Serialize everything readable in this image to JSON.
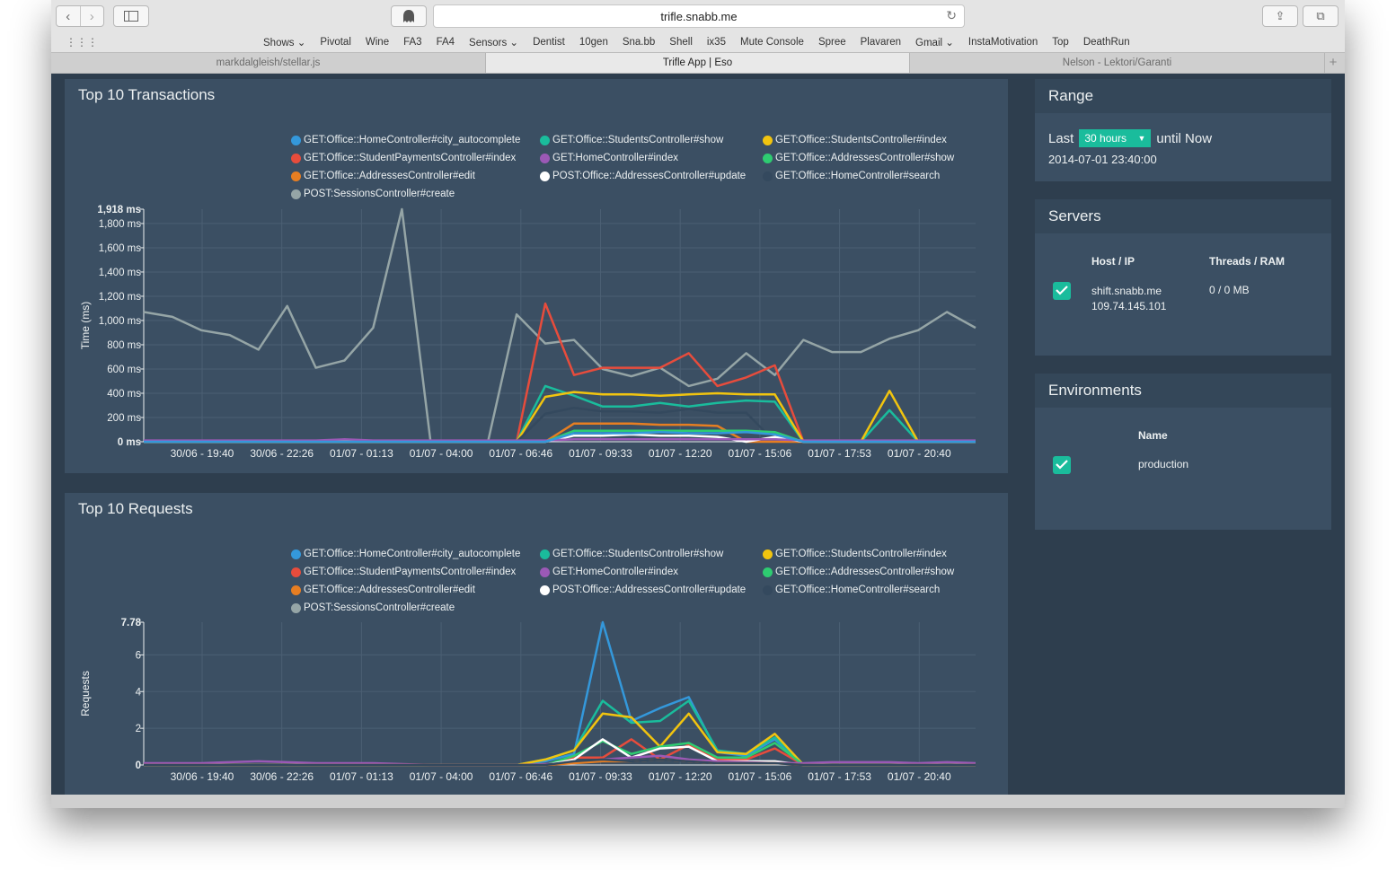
{
  "browser": {
    "url": "trifle.snabb.me",
    "bookmarks": [
      "Shows ⌄",
      "Pivotal",
      "Wine",
      "FA3",
      "FA4",
      "Sensors ⌄",
      "Dentist",
      "10gen",
      "Sna.bb",
      "Shell",
      "ix35",
      "Mute Console",
      "Spree",
      "Plavaren",
      "Gmail ⌄",
      "InstaMotivation",
      "Top",
      "DeathRun"
    ],
    "tabs": [
      "markdalgleish/stellar.js",
      "Trifle App | Eso",
      "Nelson - Lektori/Garanti"
    ]
  },
  "legend": [
    {
      "label": "GET:Office::HomeController#city_autocomplete",
      "color": "#3498db"
    },
    {
      "label": "GET:Office::StudentsController#show",
      "color": "#1abc9c"
    },
    {
      "label": "GET:Office::StudentsController#index",
      "color": "#f1c40f"
    },
    {
      "label": "GET:Office::StudentPaymentsController#index",
      "color": "#e74c3c"
    },
    {
      "label": "GET:HomeController#index",
      "color": "#9b59b6"
    },
    {
      "label": "GET:Office::AddressesController#show",
      "color": "#2ecc71"
    },
    {
      "label": "GET:Office::AddressesController#edit",
      "color": "#e67e22"
    },
    {
      "label": "POST:Office::AddressesController#update",
      "color": "#ffffff"
    },
    {
      "label": "GET:Office::HomeController#search",
      "color": "#34495e"
    },
    {
      "label": "POST:SessionsController#create",
      "color": "#95a5a6"
    }
  ],
  "x_ticks": [
    "30/06 - 19:40",
    "30/06 - 22:26",
    "01/07 - 01:13",
    "01/07 - 04:00",
    "01/07 - 06:46",
    "01/07 - 09:33",
    "01/07 - 12:20",
    "01/07 - 15:06",
    "01/07 - 17:53",
    "01/07 - 20:40"
  ],
  "chart_data": [
    {
      "type": "line",
      "title": "Top 10 Transactions",
      "ylabel": "Time (ms)",
      "y_max_label": "1,918 ms",
      "y_tick_labels": [
        "0 ms",
        "200 ms",
        "400 ms",
        "600 ms",
        "800 ms",
        "1,000 ms",
        "1,200 ms",
        "1,400 ms",
        "1,600 ms",
        "1,800 ms"
      ],
      "y_tick_values": [
        0,
        200,
        400,
        600,
        800,
        1000,
        1200,
        1400,
        1600,
        1800
      ],
      "ylim": [
        0,
        1918
      ],
      "x_ticks": [
        "30/06 - 19:40",
        "30/06 - 22:26",
        "01/07 - 01:13",
        "01/07 - 04:00",
        "01/07 - 06:46",
        "01/07 - 09:33",
        "01/07 - 12:20",
        "01/07 - 15:06",
        "01/07 - 17:53",
        "01/07 - 20:40"
      ],
      "series": [
        {
          "name": "POST:SessionsController#create",
          "color": "#95a5a6",
          "values": [
            1070,
            1030,
            920,
            880,
            760,
            1120,
            610,
            670,
            940,
            1918,
            0,
            0,
            0,
            1050,
            810,
            840,
            600,
            540,
            610,
            460,
            520,
            730,
            550,
            840,
            740,
            740,
            850,
            920,
            1070,
            940
          ]
        },
        {
          "name": "GET:Office::StudentPaymentsController#index",
          "color": "#e74c3c",
          "values": [
            0,
            0,
            0,
            0,
            0,
            0,
            0,
            0,
            0,
            0,
            0,
            0,
            0,
            0,
            1140,
            550,
            610,
            610,
            610,
            730,
            460,
            530,
            630,
            0,
            0,
            0,
            0,
            0,
            0,
            0
          ]
        },
        {
          "name": "GET:Office::StudentsController#show",
          "color": "#1abc9c",
          "values": [
            0,
            0,
            0,
            0,
            0,
            0,
            0,
            0,
            0,
            0,
            0,
            0,
            0,
            0,
            460,
            380,
            290,
            290,
            320,
            290,
            320,
            340,
            330,
            0,
            0,
            0,
            260,
            0,
            0,
            0
          ]
        },
        {
          "name": "GET:Office::StudentsController#index",
          "color": "#f1c40f",
          "values": [
            0,
            0,
            0,
            0,
            0,
            0,
            0,
            0,
            0,
            0,
            0,
            0,
            0,
            0,
            370,
            410,
            390,
            390,
            380,
            390,
            400,
            390,
            390,
            0,
            0,
            0,
            420,
            0,
            0,
            0
          ]
        },
        {
          "name": "GET:Office::HomeController#search",
          "color": "#34495e",
          "values": [
            0,
            0,
            0,
            0,
            0,
            0,
            0,
            0,
            0,
            0,
            0,
            0,
            0,
            0,
            230,
            280,
            250,
            250,
            240,
            270,
            240,
            240,
            0,
            0,
            0,
            0,
            0,
            0,
            0,
            0
          ]
        },
        {
          "name": "GET:Office::AddressesController#edit",
          "color": "#e67e22",
          "values": [
            0,
            0,
            0,
            0,
            0,
            0,
            0,
            0,
            0,
            0,
            0,
            0,
            0,
            0,
            0,
            150,
            150,
            150,
            140,
            140,
            130,
            0,
            0,
            0,
            0,
            0,
            0,
            0,
            0,
            0
          ]
        },
        {
          "name": "GET:Office::AddressesController#show",
          "color": "#2ecc71",
          "values": [
            0,
            0,
            0,
            0,
            0,
            0,
            0,
            0,
            0,
            0,
            0,
            0,
            0,
            0,
            0,
            90,
            90,
            90,
            90,
            90,
            90,
            90,
            80,
            0,
            0,
            0,
            0,
            0,
            0,
            0
          ]
        },
        {
          "name": "POST:Office::AddressesController#update",
          "color": "#ffffff",
          "values": [
            0,
            0,
            0,
            0,
            0,
            0,
            0,
            0,
            0,
            0,
            0,
            0,
            0,
            0,
            0,
            50,
            50,
            60,
            50,
            50,
            40,
            0,
            40,
            0,
            0,
            0,
            0,
            0,
            0,
            0
          ]
        },
        {
          "name": "GET:HomeController#index",
          "color": "#9b59b6",
          "values": [
            10,
            10,
            10,
            10,
            10,
            10,
            10,
            20,
            10,
            10,
            10,
            10,
            10,
            10,
            10,
            20,
            20,
            20,
            20,
            20,
            20,
            20,
            20,
            10,
            10,
            10,
            10,
            10,
            10,
            10
          ]
        },
        {
          "name": "GET:Office::HomeController#city_autocomplete",
          "color": "#3498db",
          "values": [
            0,
            0,
            0,
            0,
            0,
            0,
            0,
            0,
            0,
            0,
            0,
            0,
            0,
            0,
            0,
            70,
            70,
            70,
            80,
            70,
            70,
            80,
            60,
            0,
            0,
            0,
            0,
            0,
            0,
            0
          ]
        }
      ]
    },
    {
      "type": "line",
      "title": "Top 10 Requests",
      "ylabel": "Requests",
      "y_max_label": "7.78",
      "y_tick_labels": [
        "0",
        "2",
        "4",
        "6"
      ],
      "y_tick_values": [
        0,
        2,
        4,
        6
      ],
      "ylim": [
        0,
        7.78
      ],
      "x_ticks": [
        "30/06 - 19:40",
        "30/06 - 22:26",
        "01/07 - 01:13",
        "01/07 - 04:00",
        "01/07 - 06:46",
        "01/07 - 09:33",
        "01/07 - 12:20",
        "01/07 - 15:06",
        "01/07 - 17:53",
        "01/07 - 20:40"
      ],
      "series": [
        {
          "name": "GET:Office::HomeController#city_autocomplete",
          "color": "#3498db",
          "values": [
            0,
            0,
            0,
            0,
            0,
            0,
            0,
            0,
            0,
            0,
            0,
            0,
            0,
            0,
            0.2,
            0.6,
            7.78,
            2.4,
            3.1,
            3.7,
            0.7,
            0.5,
            1.4,
            0,
            0,
            0,
            0,
            0,
            0,
            0
          ]
        },
        {
          "name": "GET:Office::StudentsController#show",
          "color": "#1abc9c",
          "values": [
            0,
            0,
            0,
            0,
            0,
            0,
            0,
            0,
            0,
            0,
            0,
            0,
            0,
            0,
            0.3,
            0.8,
            3.5,
            2.3,
            2.4,
            3.5,
            0.8,
            0.6,
            1.5,
            0,
            0,
            0,
            0,
            0,
            0,
            0
          ]
        },
        {
          "name": "GET:Office::StudentsController#index",
          "color": "#f1c40f",
          "values": [
            0,
            0,
            0,
            0,
            0,
            0,
            0,
            0,
            0,
            0,
            0,
            0,
            0,
            0,
            0.3,
            0.8,
            2.8,
            2.6,
            1.0,
            2.8,
            0.7,
            0.6,
            1.7,
            0,
            0,
            0,
            0,
            0,
            0,
            0
          ]
        },
        {
          "name": "GET:Office::StudentPaymentsController#index",
          "color": "#e74c3c",
          "values": [
            0,
            0,
            0,
            0,
            0,
            0,
            0,
            0,
            0,
            0,
            0,
            0,
            0,
            0,
            0,
            0.4,
            0.4,
            1.4,
            0.3,
            1.1,
            0.3,
            0.3,
            0.9,
            0,
            0,
            0,
            0,
            0,
            0,
            0
          ]
        },
        {
          "name": "GET:Office::AddressesController#show",
          "color": "#2ecc71",
          "values": [
            0,
            0,
            0,
            0,
            0,
            0,
            0,
            0,
            0,
            0,
            0,
            0,
            0,
            0,
            0,
            0.5,
            1.3,
            0.6,
            1.0,
            1.2,
            0.4,
            0.4,
            1.2,
            0,
            0,
            0,
            0,
            0,
            0,
            0
          ]
        },
        {
          "name": "POST:Office::AddressesController#update",
          "color": "#ffffff",
          "values": [
            0,
            0,
            0,
            0,
            0,
            0,
            0,
            0,
            0,
            0,
            0,
            0,
            0,
            0,
            0,
            0.3,
            1.4,
            0.4,
            0.9,
            1.0,
            0.2,
            0.2,
            0.2,
            0,
            0,
            0,
            0,
            0,
            0,
            0
          ]
        },
        {
          "name": "GET:HomeController#index",
          "color": "#9b59b6",
          "values": [
            0.1,
            0.1,
            0.1,
            0.15,
            0.2,
            0.15,
            0.1,
            0.1,
            0.1,
            0.05,
            0,
            0,
            0,
            0,
            0.05,
            0.1,
            0.3,
            0.4,
            0.5,
            0.3,
            0.2,
            0.15,
            0.1,
            0.1,
            0.15,
            0.15,
            0.15,
            0.1,
            0.15,
            0.1
          ]
        },
        {
          "name": "GET:Office::AddressesController#edit",
          "color": "#e67e22",
          "values": [
            0,
            0,
            0,
            0,
            0,
            0,
            0,
            0,
            0,
            0,
            0,
            0,
            0,
            0,
            0,
            0.1,
            0.2,
            0.2,
            0.3,
            0.2,
            0.1,
            0.1,
            0.1,
            0,
            0,
            0,
            0,
            0,
            0,
            0
          ]
        },
        {
          "name": "GET:Office::HomeController#search",
          "color": "#34495e",
          "values": [
            0,
            0,
            0,
            0,
            0,
            0,
            0,
            0,
            0,
            0,
            0,
            0,
            0,
            0,
            0,
            0.2,
            0.3,
            0.2,
            0.3,
            0.2,
            0.1,
            0.1,
            0.1,
            0,
            0,
            0,
            0,
            0,
            0,
            0
          ]
        }
      ]
    }
  ],
  "range": {
    "title": "Range",
    "prefix": "Last",
    "selected": "30 hours",
    "suffix": "until Now",
    "date": "2014-07-01 23:40:00"
  },
  "servers": {
    "title": "Servers",
    "col_host": "Host / IP",
    "col_threads": "Threads / RAM",
    "host": "shift.snabb.me",
    "ip": "109.74.145.101",
    "threads": "0 / 0 MB"
  },
  "environments": {
    "title": "Environments",
    "col_name": "Name",
    "name": "production"
  }
}
